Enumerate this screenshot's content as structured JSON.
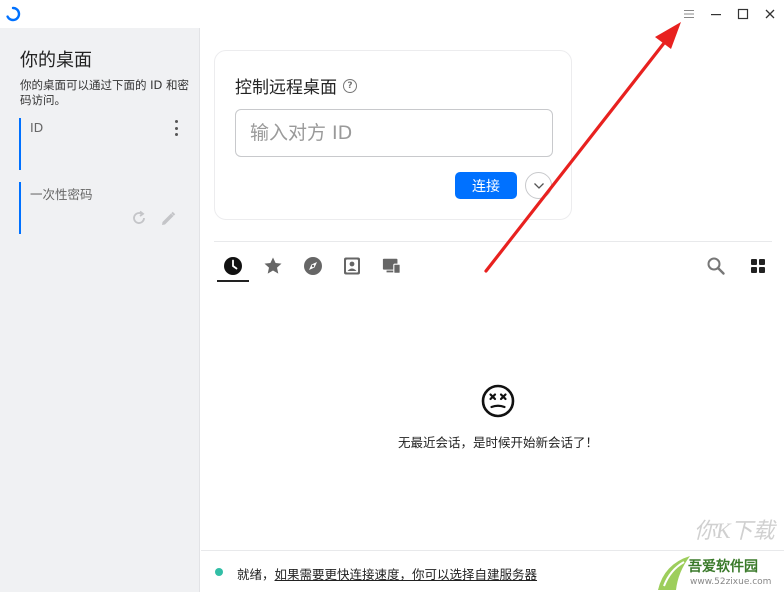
{
  "window": {
    "menu_icon": "hamburger-icon",
    "minimize_icon": "minimize-icon",
    "maximize_icon": "maximize-icon",
    "close_icon": "close-icon"
  },
  "left_panel": {
    "title": "你的桌面",
    "description": "你的桌面可以通过下面的 ID 和密码访问。",
    "id_label": "ID",
    "password_label": "一次性密码"
  },
  "connect_card": {
    "title": "控制远程桌面",
    "id_placeholder": "输入对方 ID",
    "connect_label": "连接"
  },
  "tabs": [
    {
      "icon": "clock-icon",
      "active": true
    },
    {
      "icon": "star-icon",
      "active": false
    },
    {
      "icon": "compass-icon",
      "active": false
    },
    {
      "icon": "address-book-icon",
      "active": false
    },
    {
      "icon": "devices-icon",
      "active": false
    }
  ],
  "empty_state": {
    "icon": "dizzy-face-icon",
    "message": "无最近会话，是时候开始新会话了！"
  },
  "status": {
    "state": "就绪，",
    "link": "如果需要更快连接速度，你可以选择自建服务器"
  },
  "watermark": {
    "brand": "吾爱软件园",
    "url": "www.52zixue.com"
  },
  "colors": {
    "accent": "#0071ff",
    "status_dot": "#32bea6",
    "annotation_arrow": "#e8211f"
  }
}
